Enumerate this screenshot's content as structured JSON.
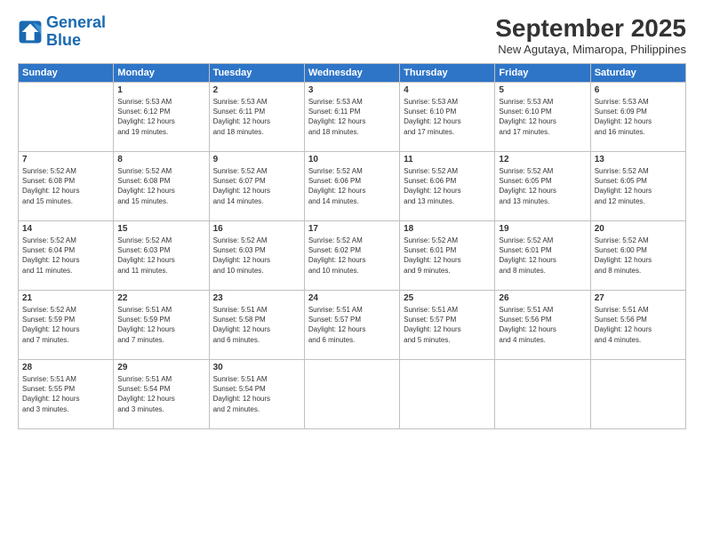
{
  "header": {
    "logo_line1": "General",
    "logo_line2": "Blue",
    "month": "September 2025",
    "location": "New Agutaya, Mimaropa, Philippines"
  },
  "days_of_week": [
    "Sunday",
    "Monday",
    "Tuesday",
    "Wednesday",
    "Thursday",
    "Friday",
    "Saturday"
  ],
  "weeks": [
    [
      {
        "day": "",
        "info": ""
      },
      {
        "day": "1",
        "info": "Sunrise: 5:53 AM\nSunset: 6:12 PM\nDaylight: 12 hours\nand 19 minutes."
      },
      {
        "day": "2",
        "info": "Sunrise: 5:53 AM\nSunset: 6:11 PM\nDaylight: 12 hours\nand 18 minutes."
      },
      {
        "day": "3",
        "info": "Sunrise: 5:53 AM\nSunset: 6:11 PM\nDaylight: 12 hours\nand 18 minutes."
      },
      {
        "day": "4",
        "info": "Sunrise: 5:53 AM\nSunset: 6:10 PM\nDaylight: 12 hours\nand 17 minutes."
      },
      {
        "day": "5",
        "info": "Sunrise: 5:53 AM\nSunset: 6:10 PM\nDaylight: 12 hours\nand 17 minutes."
      },
      {
        "day": "6",
        "info": "Sunrise: 5:53 AM\nSunset: 6:09 PM\nDaylight: 12 hours\nand 16 minutes."
      }
    ],
    [
      {
        "day": "7",
        "info": "Sunrise: 5:52 AM\nSunset: 6:08 PM\nDaylight: 12 hours\nand 15 minutes."
      },
      {
        "day": "8",
        "info": "Sunrise: 5:52 AM\nSunset: 6:08 PM\nDaylight: 12 hours\nand 15 minutes."
      },
      {
        "day": "9",
        "info": "Sunrise: 5:52 AM\nSunset: 6:07 PM\nDaylight: 12 hours\nand 14 minutes."
      },
      {
        "day": "10",
        "info": "Sunrise: 5:52 AM\nSunset: 6:06 PM\nDaylight: 12 hours\nand 14 minutes."
      },
      {
        "day": "11",
        "info": "Sunrise: 5:52 AM\nSunset: 6:06 PM\nDaylight: 12 hours\nand 13 minutes."
      },
      {
        "day": "12",
        "info": "Sunrise: 5:52 AM\nSunset: 6:05 PM\nDaylight: 12 hours\nand 13 minutes."
      },
      {
        "day": "13",
        "info": "Sunrise: 5:52 AM\nSunset: 6:05 PM\nDaylight: 12 hours\nand 12 minutes."
      }
    ],
    [
      {
        "day": "14",
        "info": "Sunrise: 5:52 AM\nSunset: 6:04 PM\nDaylight: 12 hours\nand 11 minutes."
      },
      {
        "day": "15",
        "info": "Sunrise: 5:52 AM\nSunset: 6:03 PM\nDaylight: 12 hours\nand 11 minutes."
      },
      {
        "day": "16",
        "info": "Sunrise: 5:52 AM\nSunset: 6:03 PM\nDaylight: 12 hours\nand 10 minutes."
      },
      {
        "day": "17",
        "info": "Sunrise: 5:52 AM\nSunset: 6:02 PM\nDaylight: 12 hours\nand 10 minutes."
      },
      {
        "day": "18",
        "info": "Sunrise: 5:52 AM\nSunset: 6:01 PM\nDaylight: 12 hours\nand 9 minutes."
      },
      {
        "day": "19",
        "info": "Sunrise: 5:52 AM\nSunset: 6:01 PM\nDaylight: 12 hours\nand 8 minutes."
      },
      {
        "day": "20",
        "info": "Sunrise: 5:52 AM\nSunset: 6:00 PM\nDaylight: 12 hours\nand 8 minutes."
      }
    ],
    [
      {
        "day": "21",
        "info": "Sunrise: 5:52 AM\nSunset: 5:59 PM\nDaylight: 12 hours\nand 7 minutes."
      },
      {
        "day": "22",
        "info": "Sunrise: 5:51 AM\nSunset: 5:59 PM\nDaylight: 12 hours\nand 7 minutes."
      },
      {
        "day": "23",
        "info": "Sunrise: 5:51 AM\nSunset: 5:58 PM\nDaylight: 12 hours\nand 6 minutes."
      },
      {
        "day": "24",
        "info": "Sunrise: 5:51 AM\nSunset: 5:57 PM\nDaylight: 12 hours\nand 6 minutes."
      },
      {
        "day": "25",
        "info": "Sunrise: 5:51 AM\nSunset: 5:57 PM\nDaylight: 12 hours\nand 5 minutes."
      },
      {
        "day": "26",
        "info": "Sunrise: 5:51 AM\nSunset: 5:56 PM\nDaylight: 12 hours\nand 4 minutes."
      },
      {
        "day": "27",
        "info": "Sunrise: 5:51 AM\nSunset: 5:56 PM\nDaylight: 12 hours\nand 4 minutes."
      }
    ],
    [
      {
        "day": "28",
        "info": "Sunrise: 5:51 AM\nSunset: 5:55 PM\nDaylight: 12 hours\nand 3 minutes."
      },
      {
        "day": "29",
        "info": "Sunrise: 5:51 AM\nSunset: 5:54 PM\nDaylight: 12 hours\nand 3 minutes."
      },
      {
        "day": "30",
        "info": "Sunrise: 5:51 AM\nSunset: 5:54 PM\nDaylight: 12 hours\nand 2 minutes."
      },
      {
        "day": "",
        "info": ""
      },
      {
        "day": "",
        "info": ""
      },
      {
        "day": "",
        "info": ""
      },
      {
        "day": "",
        "info": ""
      }
    ]
  ]
}
